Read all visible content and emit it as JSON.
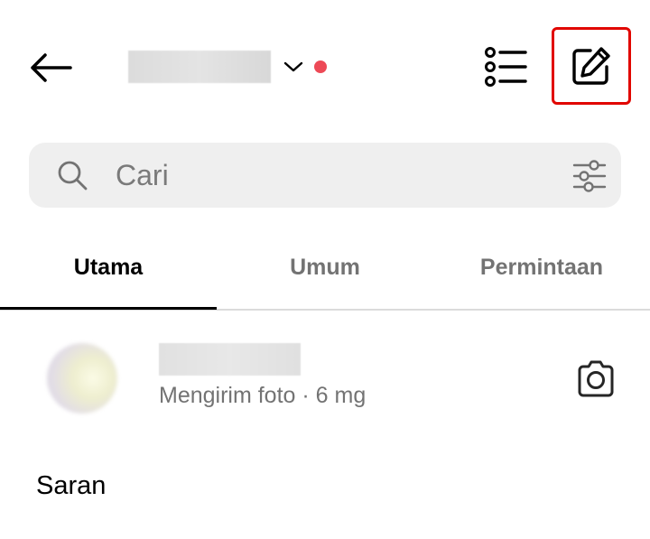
{
  "header": {
    "back_icon": "arrow-left-icon",
    "account_chevron_icon": "chevron-down-icon",
    "unread_dot_color": "#ed4956",
    "list_icon": "list-icon",
    "compose_icon": "pencil-square-icon",
    "compose_highlight_color": "#e10600"
  },
  "search": {
    "placeholder": "Cari",
    "value": "",
    "icon": "search-icon",
    "filter_icon": "sliders-icon"
  },
  "tabs": [
    {
      "label": "Utama",
      "active": true
    },
    {
      "label": "Umum",
      "active": false
    },
    {
      "label": "Permintaan",
      "active": false
    }
  ],
  "threads": [
    {
      "preview": "Mengirim foto · 6 mg",
      "action_icon": "camera-icon"
    }
  ],
  "suggestions": {
    "title": "Saran"
  }
}
